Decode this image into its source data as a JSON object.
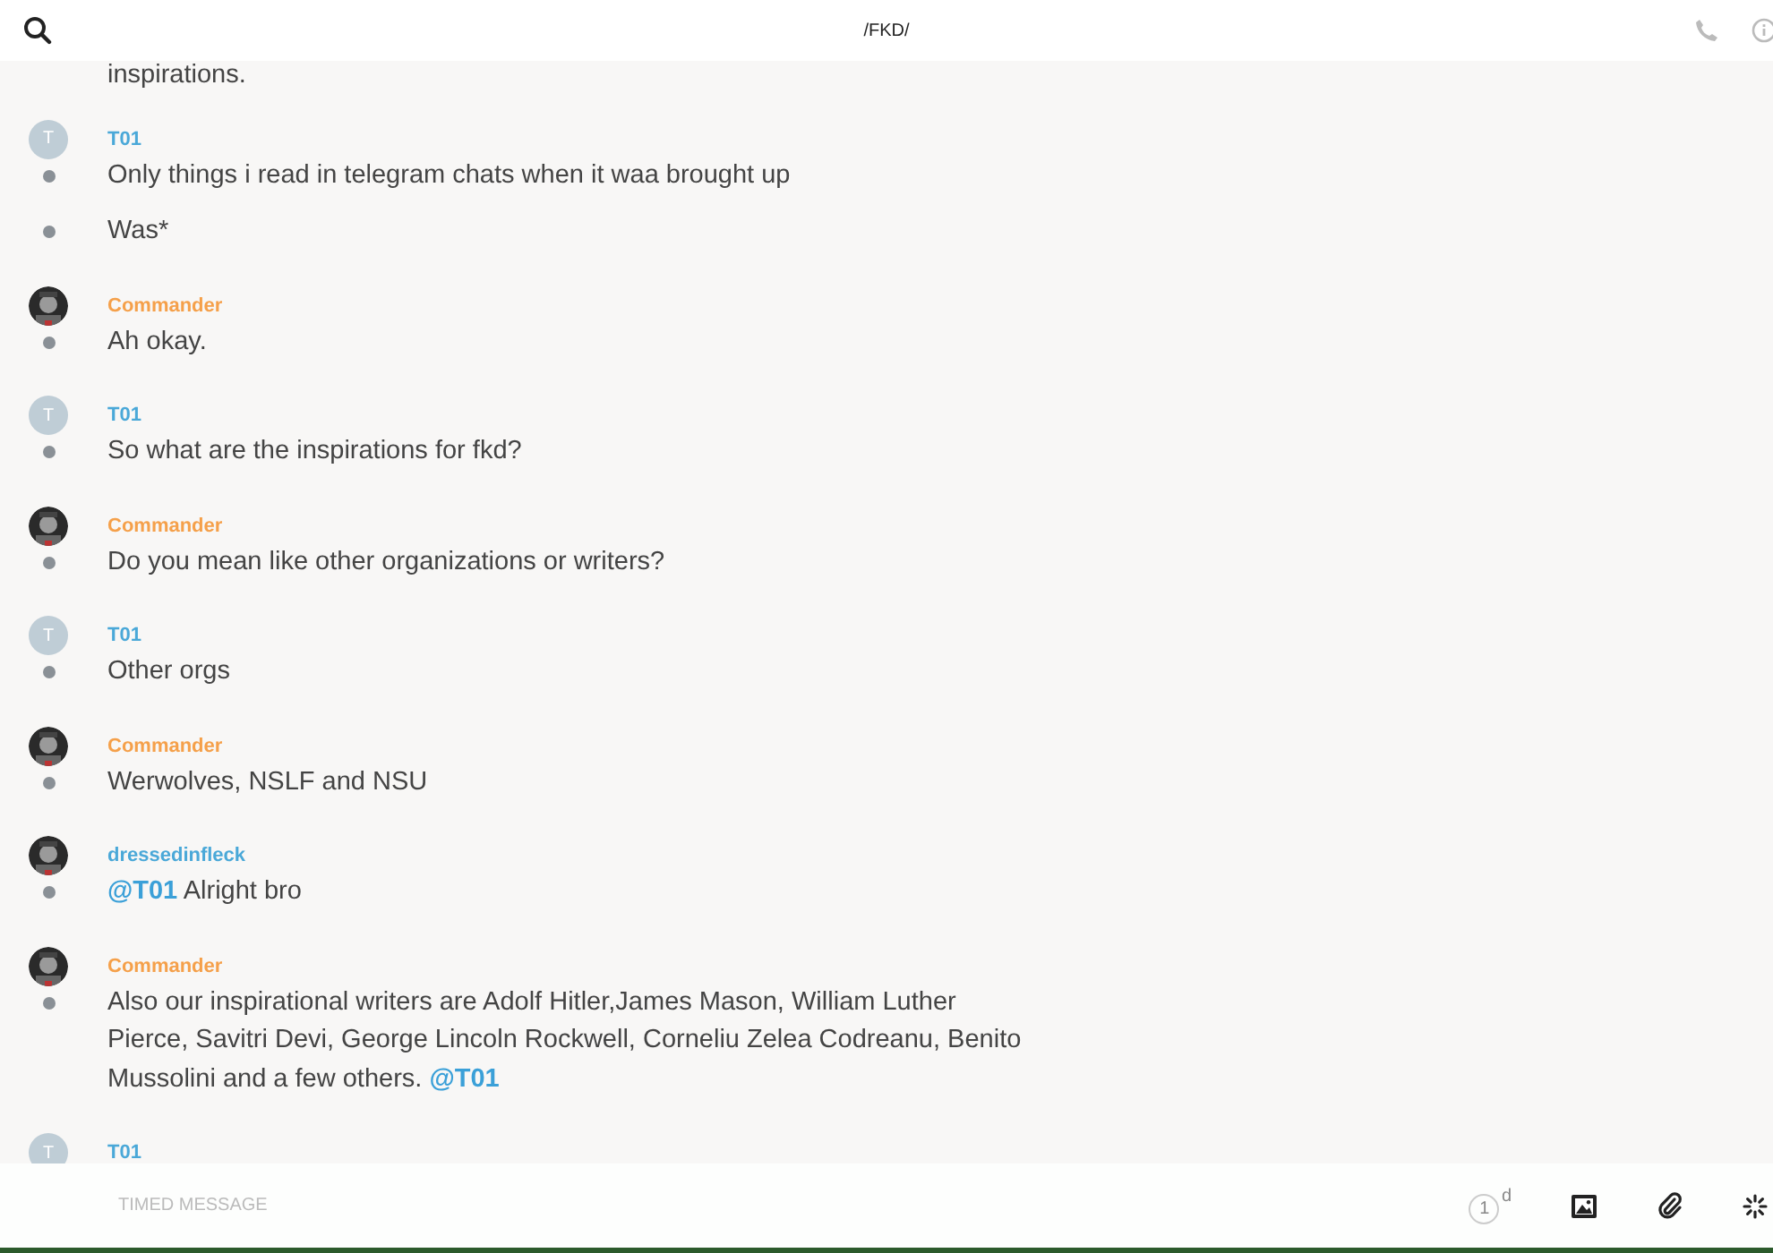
{
  "header": {
    "title": "/FKD/"
  },
  "groups": [
    {
      "lines": [
        [
          {
            "kind": "text",
            "text": "inspirations."
          }
        ]
      ]
    },
    {
      "author": "T01",
      "admin": false,
      "avatar": {
        "kind": "letter",
        "letter": "T"
      },
      "lines": [
        [
          {
            "kind": "text",
            "text": "Only things i read in telegram chats when it waa brought up"
          }
        ],
        [
          {
            "kind": "text",
            "text": "Was*"
          }
        ]
      ]
    },
    {
      "author": "Commander",
      "admin": true,
      "avatar": {
        "kind": "picture"
      },
      "lines": [
        [
          {
            "kind": "text",
            "text": "Ah okay."
          }
        ]
      ]
    },
    {
      "author": "T01",
      "admin": false,
      "avatar": {
        "kind": "letter",
        "letter": "T"
      },
      "lines": [
        [
          {
            "kind": "text",
            "text": "So what are the inspirations for fkd?"
          }
        ]
      ]
    },
    {
      "author": "Commander",
      "admin": true,
      "avatar": {
        "kind": "picture"
      },
      "lines": [
        [
          {
            "kind": "text",
            "text": "Do you mean like other organizations or writers?"
          }
        ]
      ]
    },
    {
      "author": "T01",
      "admin": false,
      "avatar": {
        "kind": "letter",
        "letter": "T"
      },
      "lines": [
        [
          {
            "kind": "text",
            "text": "Other orgs"
          }
        ]
      ]
    },
    {
      "author": "Commander",
      "admin": true,
      "avatar": {
        "kind": "picture"
      },
      "lines": [
        [
          {
            "kind": "text",
            "text": "Werwolves, NSLF and NSU"
          }
        ]
      ]
    },
    {
      "author": "dressedinfleck",
      "admin": false,
      "avatar": {
        "kind": "picture"
      },
      "lines": [
        [
          {
            "kind": "mention",
            "text": "@T01"
          },
          {
            "kind": "text",
            "text": " Alright bro"
          }
        ]
      ]
    },
    {
      "author": "Commander",
      "admin": true,
      "avatar": {
        "kind": "picture"
      },
      "lines": [
        [
          {
            "kind": "text",
            "text": "Also our inspirational writers are Adolf Hitler,James Mason, William Luther Pierce, Savitri Devi, George Lincoln Rockwell, Corneliu Zelea Codreanu, Benito Mussolini and a few others. "
          },
          {
            "kind": "mention",
            "text": "@T01"
          }
        ]
      ]
    },
    {
      "author": "T01",
      "admin": false,
      "avatar": {
        "kind": "letter",
        "letter": "T"
      }
    }
  ],
  "composer": {
    "placeholder": "TIMED MESSAGE",
    "timer": "1",
    "timer_unit": "d"
  }
}
